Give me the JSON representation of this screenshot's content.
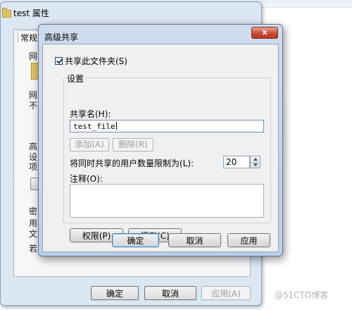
{
  "back_window": {
    "title": "test 属性",
    "tab_label": "常规",
    "fragments": [
      "网",
      "网",
      "不",
      "高",
      "设",
      "项",
      "密",
      "用",
      "文",
      "若"
    ],
    "buttons": {
      "ok": "确定",
      "cancel": "取消",
      "apply": "应用(A)"
    }
  },
  "dialog": {
    "title": "高级共享",
    "close_glyph": "x",
    "share_checkbox": {
      "label": "共享此文件夹(S)",
      "checked": true
    },
    "settings_group": "设置",
    "share_name_label": "共享名(H):",
    "share_name_value": "test_file",
    "add_button": "添加(A)",
    "remove_button": "删除(R)",
    "user_limit_label": "将同时共享的用户数量限制为(L):",
    "user_limit_value": "20",
    "comment_label": "注释(O):",
    "permissions_button": "权限(P)",
    "caching_button": "缓存(C)",
    "ok_button": "确定",
    "cancel_button": "取消",
    "apply_button": "应用"
  },
  "watermark": "@51CTO博客"
}
